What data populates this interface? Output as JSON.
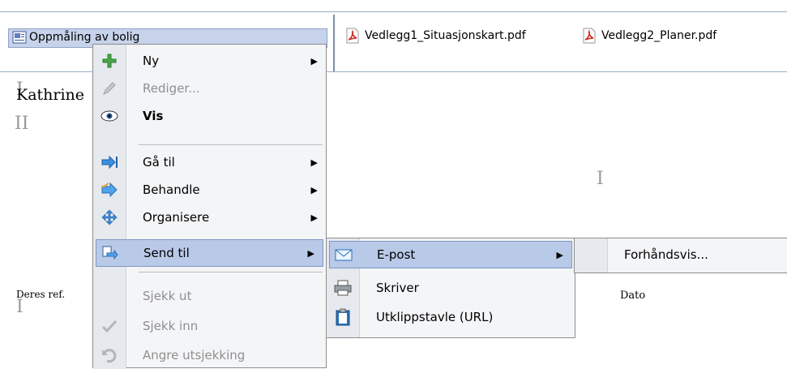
{
  "attachments": {
    "selected_item": "Oppmåling av bolig",
    "files": [
      "Vedlegg1_Situasjonskart.pdf",
      "Vedlegg2_Planer.pdf"
    ]
  },
  "document": {
    "name_fragment": "Kathrine",
    "deres_ref_label": "Deres ref.",
    "dato_label": "Dato"
  },
  "context_menu": {
    "items": [
      {
        "label": "Ny",
        "icon": "plus-icon",
        "submenu": true,
        "disabled": false
      },
      {
        "label": "Rediger...",
        "icon": "pencil-icon",
        "submenu": false,
        "disabled": true
      },
      {
        "label": "Vis",
        "icon": "eye-icon",
        "submenu": false,
        "disabled": false,
        "bold": true
      },
      {
        "label": "Gå til",
        "icon": "goto-arrow-icon",
        "submenu": true,
        "disabled": false
      },
      {
        "label": "Behandle",
        "icon": "process-arrow-icon",
        "submenu": true,
        "disabled": false
      },
      {
        "label": "Organisere",
        "icon": "move-icon",
        "submenu": true,
        "disabled": false
      },
      {
        "label": "Send til",
        "icon": "send-to-icon",
        "submenu": true,
        "disabled": false,
        "highlighted": true
      },
      {
        "label": "Sjekk ut",
        "icon": "",
        "submenu": false,
        "disabled": true
      },
      {
        "label": "Sjekk inn",
        "icon": "checkmark-icon",
        "submenu": false,
        "disabled": true
      },
      {
        "label": "Angre utsjekking",
        "icon": "undo-icon",
        "submenu": false,
        "disabled": true
      }
    ]
  },
  "send_to_menu": {
    "items": [
      {
        "label": "E-post",
        "icon": "email-icon",
        "submenu": true,
        "highlighted": true
      },
      {
        "label": "Skriver",
        "icon": "printer-icon",
        "submenu": false
      },
      {
        "label": "Utklippstavle (URL)",
        "icon": "clipboard-icon",
        "submenu": false
      }
    ]
  },
  "email_menu": {
    "items": [
      {
        "label": "Forhåndsvis..."
      }
    ]
  },
  "colors": {
    "highlight": "#b9c9e8",
    "menu_bg": "#f4f5f7",
    "disabled_text": "#8f8f8f"
  }
}
